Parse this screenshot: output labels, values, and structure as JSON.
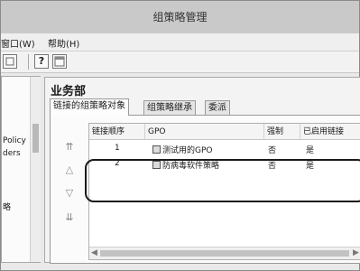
{
  "window": {
    "title": "组策略管理"
  },
  "menu": {
    "window_label": "窗口(W)",
    "help_label": "帮助(H)"
  },
  "toolbar": {
    "help_glyph": "?"
  },
  "tree": {
    "items": [
      "Policy",
      "ders",
      "略"
    ]
  },
  "content": {
    "ou_title": "业务部",
    "tabs": [
      "链接的组策略对象",
      "组策略继承",
      "委派"
    ],
    "order_buttons": [
      "⇈",
      "△",
      "▽",
      "⇊"
    ],
    "table": {
      "columns": [
        "链接顺序",
        "GPO",
        "强制",
        "已启用链接"
      ],
      "rows": [
        {
          "order": "1",
          "gpo": "测试用的GPO",
          "enforced": "否",
          "enabled": "是"
        },
        {
          "order": "2",
          "gpo": "防病毒软件策略",
          "enforced": "否",
          "enabled": "是"
        }
      ]
    },
    "scroll": {
      "left_arrow": "◀",
      "right_arrow": "▶"
    }
  }
}
